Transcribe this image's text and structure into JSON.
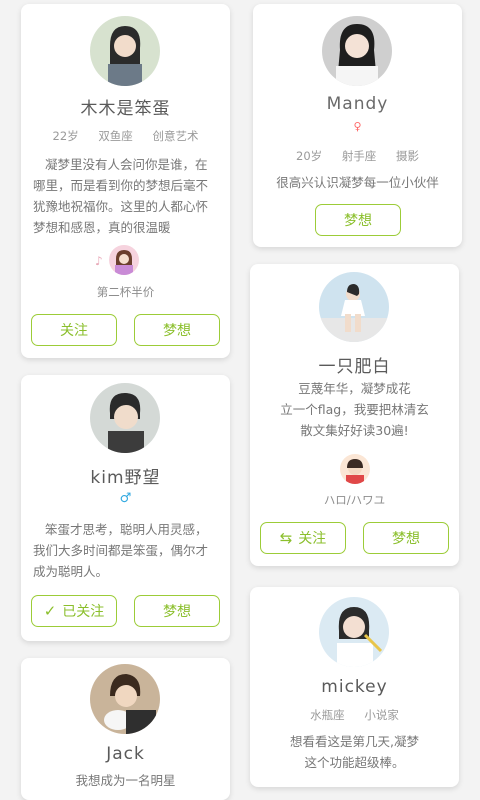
{
  "cards": [
    {
      "name": "木木是笨蛋",
      "tags": [
        "22岁",
        "双鱼座",
        "创意艺术"
      ],
      "desc": "凝梦里没有人会问你是谁，在哪里，而是看到你的梦想后毫不犹豫地祝福你。这里的人都心怀梦想和感恩，真的很温暖",
      "music_note": "♪",
      "sub_label": "第二杯半价",
      "follow_label": "关注",
      "dream_label": "梦想"
    },
    {
      "name": "Mandy",
      "gender": "♀",
      "tags": [
        "20岁",
        "射手座",
        "摄影"
      ],
      "desc": "很高兴认识凝梦每一位小伙伴",
      "dream_label": "梦想"
    },
    {
      "name": "kim野望",
      "gender": "♂",
      "desc": "笨蛋才思考，聪明人用灵感，我们大多时间都是笨蛋，偶尔才成为聪明人。",
      "followed_label": "已关注",
      "dream_label": "梦想"
    },
    {
      "name": "一只肥白",
      "desc": "豆蔑年华，凝梦成花\n立一个flag，我要把林清玄\n散文集好好读30遍!",
      "sub_label": "ハロ/ハワユ",
      "follow_label": "关注",
      "dream_label": "梦想"
    },
    {
      "name": "Jack",
      "desc": "我想成为一名明星"
    },
    {
      "name": "mickey",
      "tags": [
        "水瓶座",
        "小说家"
      ],
      "desc": "想看看这是第几天,凝梦\n这个功能超级棒。"
    }
  ],
  "icons": {
    "check": "✓",
    "swap": "⇆"
  },
  "colors": {
    "accent": "#8bbf2c",
    "female": "#ff6a6a",
    "male": "#2fa8e0"
  }
}
